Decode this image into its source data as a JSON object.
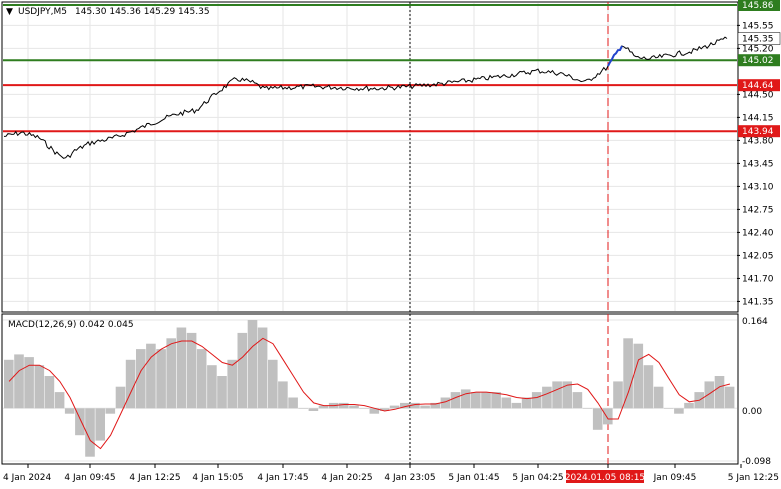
{
  "header": {
    "arrow_glyph": "▼",
    "symbol": "USDJPY,M5",
    "ohlc": "145.30 145.36 145.29 145.35"
  },
  "price_axis": {
    "ticks": [
      "145.55",
      "145.20",
      "144.50",
      "144.15",
      "143.80",
      "143.45",
      "143.10",
      "142.75",
      "142.40",
      "142.05",
      "141.70",
      "141.35"
    ]
  },
  "levels": [
    {
      "id": "level-145-86",
      "price": 145.86,
      "label": "145.86",
      "color": "#2e7d1f"
    },
    {
      "id": "level-145-02",
      "price": 145.02,
      "label": "145.02",
      "color": "#2e7d1f"
    },
    {
      "id": "level-144-64",
      "price": 144.64,
      "label": "144.64",
      "color": "#e01818"
    },
    {
      "id": "level-143-94",
      "price": 143.94,
      "label": "143.94",
      "color": "#e01818"
    }
  ],
  "current_price": {
    "value": 145.35,
    "label": "145.35"
  },
  "macd": {
    "title": "MACD(12,26,9) 0.042 0.045",
    "axis_labels": {
      "top": "0.164",
      "zero": "0.00",
      "bottom": "-0.098"
    }
  },
  "time_axis": {
    "labels": [
      "4 Jan 2024",
      "4 Jan 09:45",
      "4 Jan 12:25",
      "4 Jan 15:05",
      "4 Jan 17:45",
      "4 Jan 20:25",
      "4 Jan 23:05",
      "5 Jan 01:45",
      "5 Jan 04:25",
      "2024.01.05 08:15",
      "Jan 09:45",
      "5 Jan 12:25"
    ],
    "highlighted": "2024.01.05 08:15"
  },
  "colors": {
    "price_line": "#000000",
    "recent_segment": "#2244cc",
    "histogram": "#c0c0c0",
    "signal_line": "#e01818",
    "grid": "#e6e6e6",
    "crosshair": "#000000",
    "marker_line": "#e01818"
  },
  "chart_data": {
    "type": "line",
    "series": [
      {
        "name": "USDJPY,M5",
        "points": [
          [
            "4 Jan 00:00",
            143.86
          ],
          [
            "4 Jan 02:00",
            143.92
          ],
          [
            "4 Jan 04:00",
            143.84
          ],
          [
            "4 Jan 06:00",
            143.6
          ],
          [
            "4 Jan 07:00",
            143.52
          ],
          [
            "4 Jan 08:00",
            143.64
          ],
          [
            "4 Jan 09:45",
            143.76
          ],
          [
            "4 Jan 10:45",
            143.84
          ],
          [
            "4 Jan 11:30",
            143.94
          ],
          [
            "4 Jan 12:25",
            144.08
          ],
          [
            "4 Jan 13:20",
            144.2
          ],
          [
            "4 Jan 14:10",
            144.26
          ],
          [
            "4 Jan 15:05",
            144.54
          ],
          [
            "4 Jan 15:50",
            144.74
          ],
          [
            "4 Jan 16:30",
            144.68
          ],
          [
            "4 Jan 17:00",
            144.58
          ],
          [
            "4 Jan 17:45",
            144.6
          ],
          [
            "4 Jan 19:00",
            144.62
          ],
          [
            "4 Jan 20:25",
            144.6
          ],
          [
            "4 Jan 21:40",
            144.59
          ],
          [
            "4 Jan 23:05",
            144.62
          ],
          [
            "5 Jan 00:20",
            144.66
          ],
          [
            "5 Jan 01:45",
            144.72
          ],
          [
            "5 Jan 03:00",
            144.78
          ],
          [
            "5 Jan 04:25",
            144.86
          ],
          [
            "5 Jan 05:40",
            144.82
          ],
          [
            "5 Jan 07:00",
            144.68
          ],
          [
            "5 Jan 08:15",
            144.92
          ],
          [
            "5 Jan 08:45",
            145.26
          ],
          [
            "5 Jan 09:15",
            145.06
          ],
          [
            "5 Jan 09:45",
            145.04
          ],
          [
            "5 Jan 10:30",
            145.1
          ],
          [
            "5 Jan 11:15",
            145.16
          ],
          [
            "5 Jan 12:00",
            145.28
          ],
          [
            "5 Jan 12:25",
            145.35
          ]
        ]
      },
      {
        "name": "MACD(12,26,9)",
        "histogram": [
          0.09,
          0.1,
          0.095,
          0.08,
          0.06,
          0.03,
          -0.01,
          -0.05,
          -0.09,
          -0.06,
          -0.01,
          0.04,
          0.09,
          0.11,
          0.12,
          0.11,
          0.13,
          0.15,
          0.14,
          0.11,
          0.08,
          0.06,
          0.09,
          0.14,
          0.164,
          0.15,
          0.09,
          0.05,
          0.02,
          0.0,
          -0.005,
          0.005,
          0.01,
          0.01,
          0.005,
          0.0,
          -0.01,
          -0.005,
          0.005,
          0.01,
          0.01,
          0.005,
          0.01,
          0.02,
          0.03,
          0.035,
          0.03,
          0.03,
          0.03,
          0.02,
          0.01,
          0.02,
          0.03,
          0.04,
          0.05,
          0.05,
          0.03,
          0.0,
          -0.04,
          -0.03,
          0.05,
          0.13,
          0.12,
          0.08,
          0.04,
          0.0,
          -0.01,
          0.01,
          0.03,
          0.05,
          0.06,
          0.04
        ],
        "signal": [
          0.05,
          0.07,
          0.08,
          0.08,
          0.07,
          0.05,
          0.02,
          -0.02,
          -0.06,
          -0.075,
          -0.05,
          -0.01,
          0.03,
          0.07,
          0.095,
          0.11,
          0.12,
          0.125,
          0.125,
          0.115,
          0.1,
          0.085,
          0.08,
          0.095,
          0.115,
          0.13,
          0.12,
          0.09,
          0.06,
          0.03,
          0.01,
          0.005,
          0.005,
          0.007,
          0.007,
          0.005,
          0.0,
          -0.005,
          -0.002,
          0.003,
          0.007,
          0.008,
          0.008,
          0.012,
          0.02,
          0.027,
          0.03,
          0.03,
          0.028,
          0.025,
          0.02,
          0.018,
          0.02,
          0.027,
          0.035,
          0.043,
          0.045,
          0.035,
          0.01,
          -0.02,
          -0.02,
          0.03,
          0.09,
          0.1,
          0.085,
          0.055,
          0.025,
          0.012,
          0.015,
          0.027,
          0.04,
          0.045
        ]
      }
    ],
    "ylim": [
      141.25,
      145.86
    ],
    "macd_ylim": [
      -0.098,
      0.164
    ],
    "grid": true
  }
}
